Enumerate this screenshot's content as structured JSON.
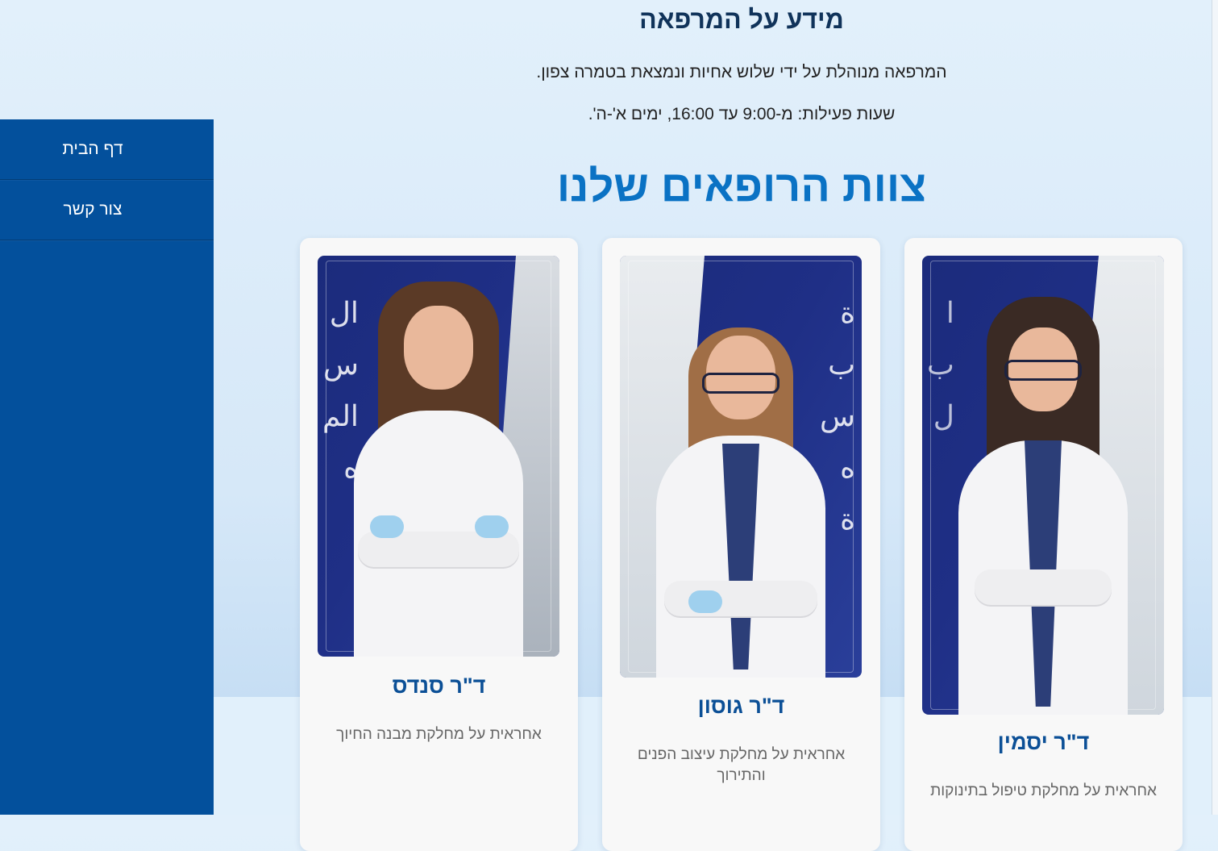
{
  "clinic_info": {
    "title": "מידע על המרפאה",
    "description": "המרפאה מנוהלת על ידי שלוש אחיות ונמצאת בטמרה צפון.",
    "hours": "שעות פעילות: מ-9:00 עד 16:00, ימים א'-ה'."
  },
  "sidebar": {
    "items": [
      {
        "label": "דף הבית"
      },
      {
        "label": "צור קשר"
      }
    ]
  },
  "team": {
    "title": "צוות הרופאים שלנו",
    "doctors": [
      {
        "name": "ד\"ר יסמין",
        "description": "אחראית על מחלקת טיפול בתינוקות",
        "photo": "doctor-yasmin-photo"
      },
      {
        "name": "ד\"ר גוסון",
        "description": "אחראית על מחלקת עיצוב הפנים והתירוך",
        "photo": "doctor-goson-photo"
      },
      {
        "name": "ד\"ר סנדס",
        "description": "אחראית על מחלקת מבנה החיוך",
        "photo": "doctor-sands-photo"
      }
    ]
  },
  "colors": {
    "sidebar": "#03509c",
    "accent_title": "#0a72c4",
    "doctor_name": "#0b4f96",
    "page_background": "#d6e8f8"
  }
}
